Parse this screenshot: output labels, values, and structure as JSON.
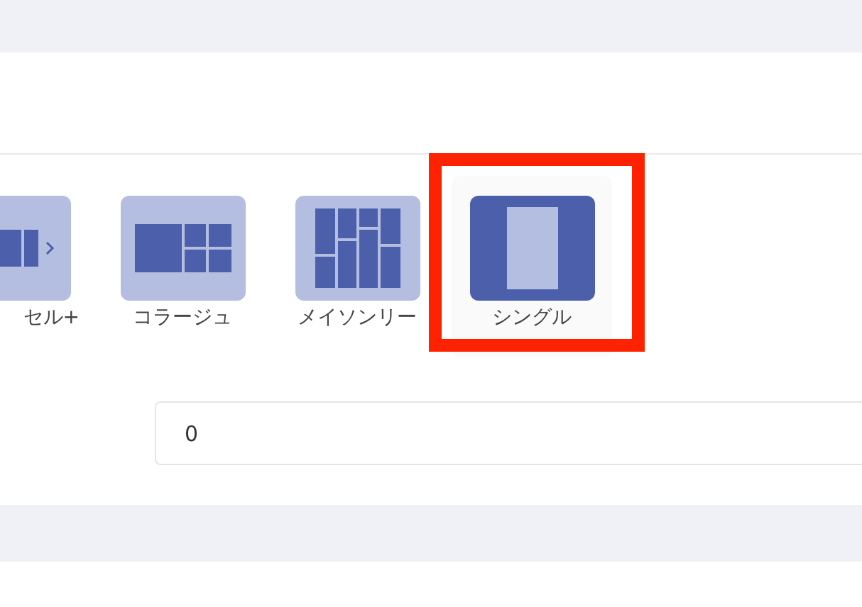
{
  "layouts": [
    {
      "label": "セル+",
      "kind": "carousel",
      "selected": false
    },
    {
      "label": "コラージュ",
      "kind": "collage",
      "selected": false
    },
    {
      "label": "メイソンリー",
      "kind": "masonry",
      "selected": false
    },
    {
      "label": "シングル",
      "kind": "single",
      "selected": true
    }
  ],
  "field": {
    "value": "0"
  }
}
